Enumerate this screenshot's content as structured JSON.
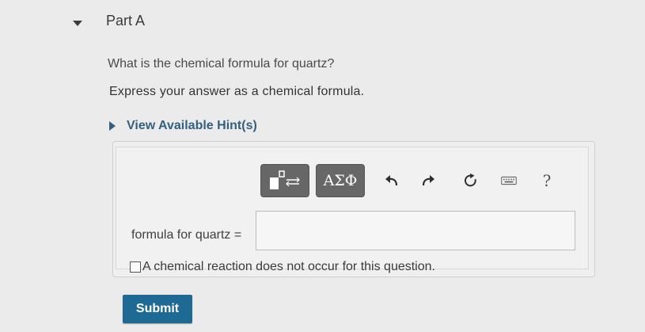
{
  "part": {
    "title": "Part A"
  },
  "question": {
    "text": "What is the chemical formula for quartz?",
    "instruction": "Express your answer as a chemical formula.",
    "hint_link": "View Available Hint(s)"
  },
  "toolbar": {
    "templates_icon": "templates-icon",
    "greek_label": "ΑΣΦ",
    "undo_icon": "undo-icon",
    "redo_icon": "redo-icon",
    "reset_icon": "reset-icon",
    "keyboard_icon": "keyboard-icon",
    "help_label": "?"
  },
  "answer": {
    "label": "formula for quartz =",
    "value": "",
    "placeholder": ""
  },
  "no_reaction": {
    "label": "A chemical reaction does not occur for this question.",
    "checked": false
  },
  "submit": {
    "label": "Submit"
  },
  "colors": {
    "background": "#ebebeb",
    "accent": "#1e6a94",
    "hint_link": "#34607f",
    "toolbar_button": "#676767"
  }
}
